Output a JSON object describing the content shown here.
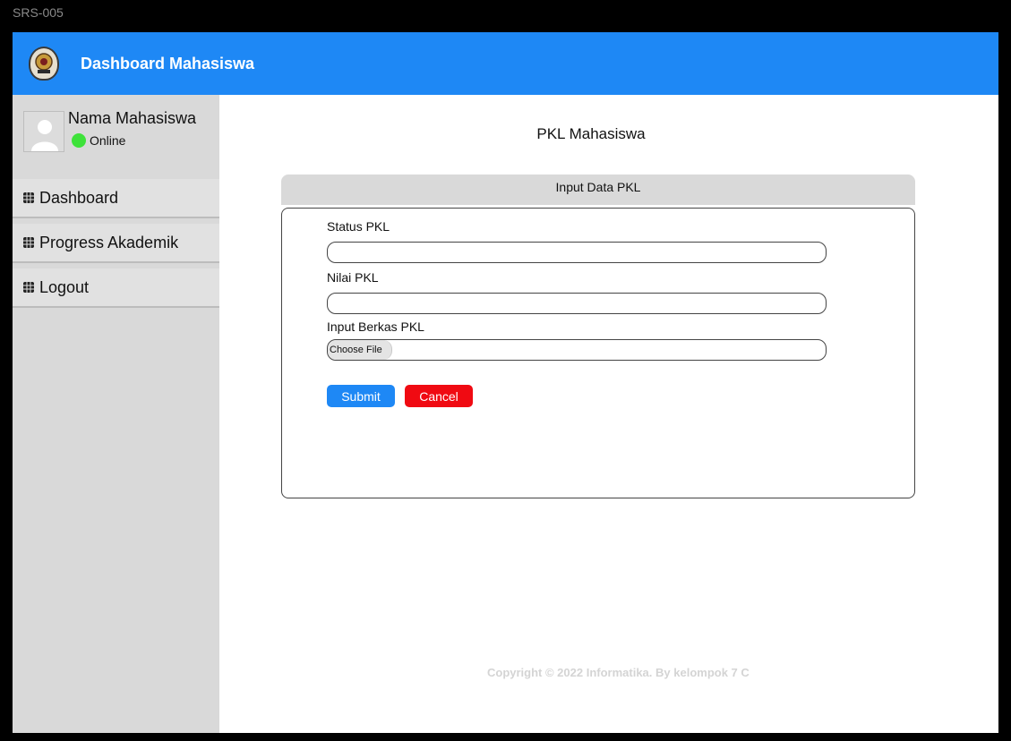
{
  "frame_label": "SRS-005",
  "header": {
    "title": "Dashboard Mahasiswa",
    "logo_icon": "university-seal-icon",
    "color": "#1e88f5"
  },
  "sidebar": {
    "user": {
      "name": "Nama Mahasiswa",
      "status": "Online",
      "status_color": "#3ee23a"
    },
    "items": [
      {
        "label": "Dashboard",
        "icon": "grid-icon"
      },
      {
        "label": "Progress Akademik",
        "icon": "grid-icon"
      },
      {
        "label": "Logout",
        "icon": "grid-icon"
      }
    ]
  },
  "main": {
    "page_title": "PKL Mahasiswa",
    "card_title": "Input Data PKL",
    "fields": {
      "status_label": "Status PKL",
      "status_value": "",
      "nilai_label": "Nilai PKL",
      "nilai_value": "",
      "berkas_label": "Input Berkas PKL",
      "choose_file_label": "Choose File"
    },
    "buttons": {
      "submit": "Submit",
      "cancel": "Cancel",
      "submit_color": "#1e88f5",
      "cancel_color": "#f00a12"
    }
  },
  "footer": {
    "copyright": "Copyright © 2022 Informatika. By kelompok 7 C"
  }
}
